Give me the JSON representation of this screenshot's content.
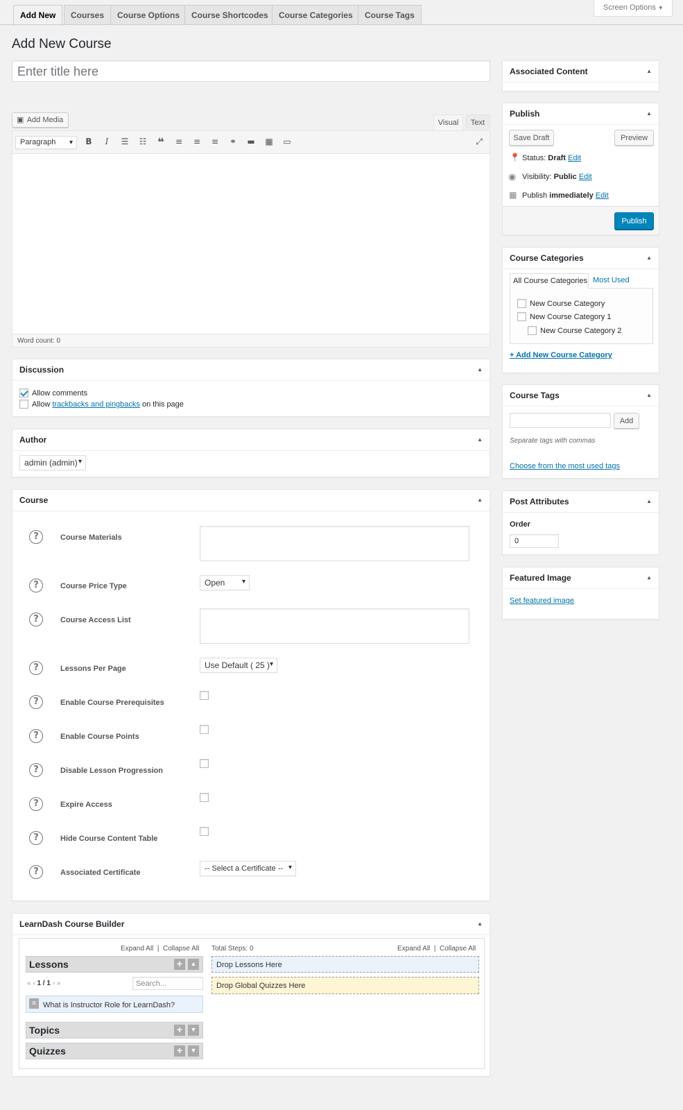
{
  "tabs": [
    "Add New",
    "Courses",
    "Course Options",
    "Course Shortcodes",
    "Course Categories",
    "Course Tags"
  ],
  "screen_options": "Screen Options",
  "page_title": "Add New Course",
  "title_placeholder": "Enter title here",
  "editor": {
    "add_media": "Add Media",
    "visual_tab": "Visual",
    "text_tab": "Text",
    "format_select": "Paragraph",
    "word_count": "Word count: 0"
  },
  "discussion": {
    "title": "Discussion",
    "allow_comments": "Allow comments",
    "allow_prefix": "Allow ",
    "trackbacks_link": "trackbacks and pingbacks",
    "allow_suffix": " on this page"
  },
  "author": {
    "title": "Author",
    "selected": "admin (admin)"
  },
  "course": {
    "title": "Course",
    "fields": [
      {
        "label": "Course Materials"
      },
      {
        "label": "Course Price Type",
        "value": "Open"
      },
      {
        "label": "Course Access List"
      },
      {
        "label": "Lessons Per Page",
        "value": "Use Default ( 25 )"
      },
      {
        "label": "Enable Course Prerequisites"
      },
      {
        "label": "Enable Course Points"
      },
      {
        "label": "Disable Lesson Progression"
      },
      {
        "label": "Expire Access"
      },
      {
        "label": "Hide Course Content Table"
      },
      {
        "label": "Associated Certificate",
        "value": "-- Select a Certificate --"
      }
    ]
  },
  "builder": {
    "title": "LearnDash Course Builder",
    "expand_all": "Expand All",
    "collapse_all": "Collapse All",
    "separator": "|",
    "total_steps": "Total Steps: 0",
    "lessons": "Lessons",
    "topics": "Topics",
    "quizzes": "Quizzes",
    "pagination": "1 / 1",
    "search_placeholder": "Search...",
    "lesson_item": "What is Instructor Role for LearnDash?",
    "drop_lessons": "Drop Lessons Here",
    "drop_quizzes": "Drop Global Quizzes Here"
  },
  "associated_content": {
    "title": "Associated Content"
  },
  "publish": {
    "title": "Publish",
    "save_draft": "Save Draft",
    "preview": "Preview",
    "status_label": "Status: ",
    "status_value": "Draft",
    "visibility_label": "Visibility: ",
    "visibility_value": "Public",
    "publish_label": "Publish ",
    "publish_value": "immediately",
    "edit": "Edit",
    "publish_button": "Publish"
  },
  "categories": {
    "title": "Course Categories",
    "tab_all": "All Course Categories",
    "tab_most_used": "Most Used",
    "items": [
      "New Course Category",
      "New Course Category 1",
      "New Course Category 2"
    ],
    "add_new": "+ Add New Course Category"
  },
  "tags": {
    "title": "Course Tags",
    "add": "Add",
    "hint": "Separate tags with commas",
    "choose": "Choose from the most used tags"
  },
  "attributes": {
    "title": "Post Attributes",
    "order_label": "Order",
    "order_value": "0"
  },
  "featured": {
    "title": "Featured Image",
    "set": "Set featured image"
  },
  "colors": {
    "primary": "#0085ba",
    "link": "#0073aa",
    "background": "#f1f1f1"
  }
}
